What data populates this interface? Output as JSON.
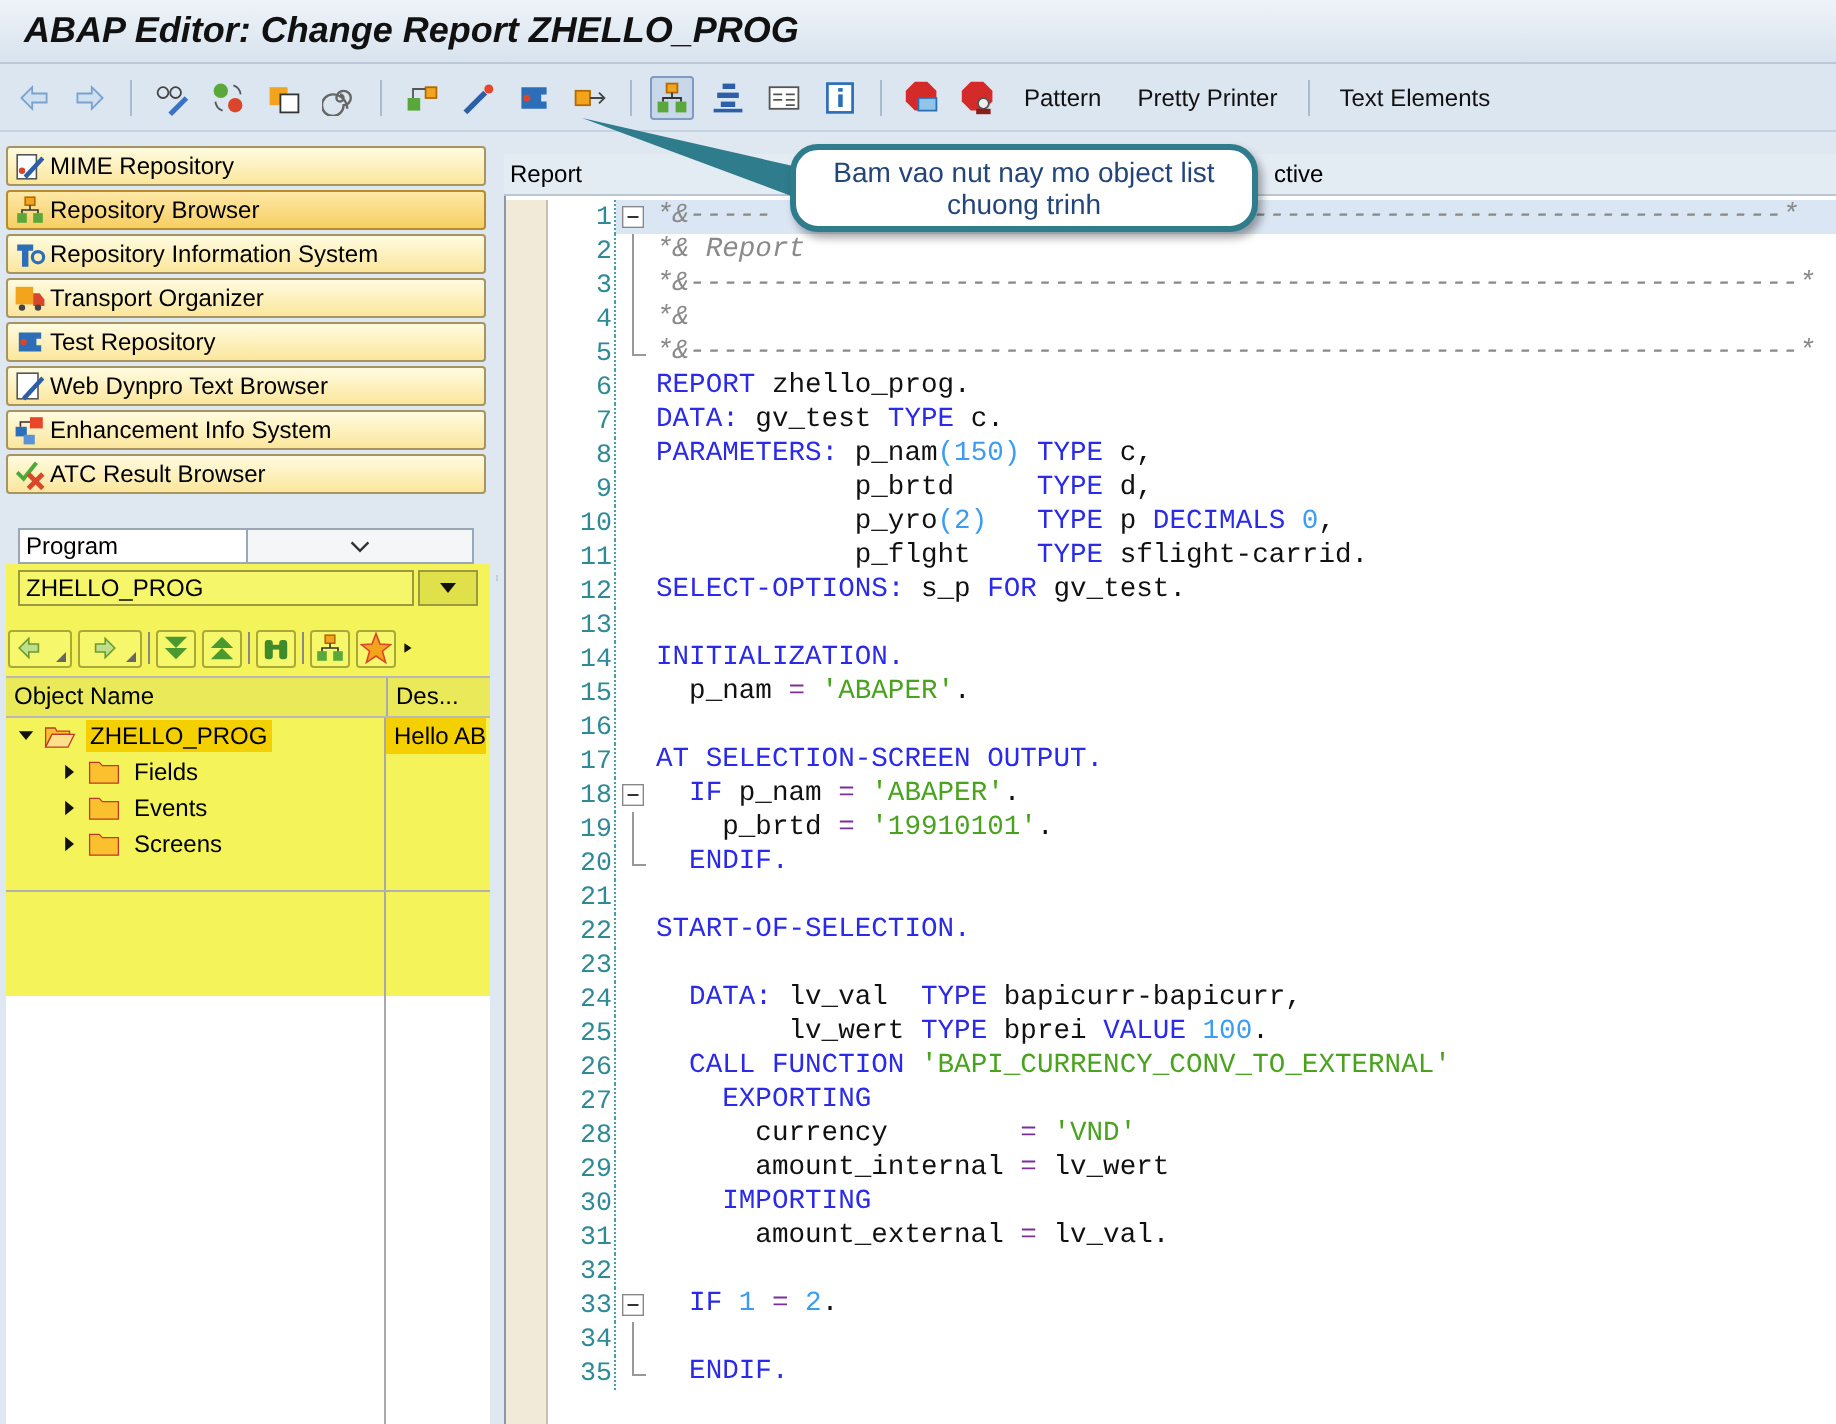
{
  "window": {
    "title": "ABAP Editor: Change Report ZHELLO_PROG"
  },
  "toolbar": [
    {
      "kind": "icon",
      "selected": false
    },
    {
      "kind": "icon",
      "selected": false
    },
    {
      "kind": "separator"
    },
    {
      "kind": "icon",
      "selected": false
    },
    {
      "kind": "icon",
      "selected": false
    },
    {
      "kind": "icon",
      "selected": false
    },
    {
      "kind": "icon",
      "selected": false
    },
    {
      "kind": "separator"
    },
    {
      "kind": "icon",
      "selected": false
    },
    {
      "kind": "icon",
      "selected": false
    },
    {
      "kind": "icon",
      "selected": false
    },
    {
      "kind": "icon",
      "selected": false
    },
    {
      "kind": "separator"
    },
    {
      "kind": "icon",
      "selected": true
    },
    {
      "kind": "icon",
      "selected": false
    },
    {
      "kind": "icon",
      "selected": false
    },
    {
      "kind": "icon",
      "selected": false
    },
    {
      "kind": "separator"
    },
    {
      "kind": "icon",
      "selected": false
    },
    {
      "kind": "icon",
      "selected": false
    },
    {
      "kind": "button",
      "label": "Pattern"
    },
    {
      "kind": "button",
      "label": "Pretty Printer"
    },
    {
      "kind": "separator"
    },
    {
      "kind": "button",
      "label": "Text Elements"
    }
  ],
  "navigation": [
    {
      "label": "MIME Repository",
      "selected": false
    },
    {
      "label": "Repository Browser",
      "selected": true
    },
    {
      "label": "Repository Information System",
      "selected": false
    },
    {
      "label": "Transport Organizer",
      "selected": false
    },
    {
      "label": "Test Repository",
      "selected": false
    },
    {
      "label": "Web Dynpro Text Browser",
      "selected": false
    },
    {
      "label": "Enhancement Info System",
      "selected": false
    },
    {
      "label": "ATC Result Browser",
      "selected": false
    }
  ],
  "object_type": {
    "value": "Program"
  },
  "object_name": {
    "value": "ZHELLO_PROG"
  },
  "tree": {
    "columns": [
      "Object Name",
      "Des..."
    ],
    "items": [
      {
        "label": "ZHELLO_PROG",
        "description": "Hello AB",
        "expanded": true,
        "selected": true,
        "children": [
          {
            "label": "Fields",
            "expanded": false,
            "selected": false
          },
          {
            "label": "Events",
            "expanded": false,
            "selected": false
          },
          {
            "label": "Screens",
            "expanded": false,
            "selected": false
          }
        ]
      }
    ]
  },
  "editor": {
    "tab": "Report",
    "status": "ctive",
    "lines": [
      {
        "number": "1",
        "highlighted": true,
        "expanded": true,
        "tokens": [
          {
            "kind": "comment",
            "text": "*&-----"
          },
          {
            "kind": "comment",
            "text": "                             --------------------------------*"
          }
        ],
        "children": [
          {
            "number": "2",
            "highlighted": false,
            "tokens": [
              {
                "kind": "comment",
                "text": "*& Report"
              }
            ]
          },
          {
            "number": "3",
            "highlighted": false,
            "tokens": [
              {
                "kind": "comment",
                "text": "*&-------------------------------------------------------------------*"
              }
            ]
          },
          {
            "number": "4",
            "highlighted": false,
            "tokens": [
              {
                "kind": "comment",
                "text": "*&"
              }
            ]
          },
          {
            "number": "5",
            "highlighted": false,
            "tokens": [
              {
                "kind": "comment",
                "text": "*&-------------------------------------------------------------------*"
              }
            ]
          }
        ]
      },
      {
        "number": "6",
        "highlighted": false,
        "tokens": [
          {
            "kind": "keyword",
            "text": "REPORT"
          },
          {
            "kind": "plain",
            "text": " zhello_prog."
          }
        ]
      },
      {
        "number": "7",
        "highlighted": false,
        "tokens": [
          {
            "kind": "keyword",
            "text": "DATA:"
          },
          {
            "kind": "plain",
            "text": " gv_test"
          },
          {
            "kind": "keyword",
            "text": " TYPE"
          },
          {
            "kind": "plain",
            "text": " c."
          }
        ]
      },
      {
        "number": "8",
        "highlighted": false,
        "tokens": [
          {
            "kind": "keyword",
            "text": "PARAMETERS:"
          },
          {
            "kind": "plain",
            "text": " p_nam"
          },
          {
            "kind": "number",
            "text": "(150)"
          },
          {
            "kind": "keyword",
            "text": " TYPE"
          },
          {
            "kind": "plain",
            "text": " c,"
          }
        ]
      },
      {
        "number": "9",
        "highlighted": false,
        "tokens": [
          {
            "kind": "plain",
            "text": "            p_brtd"
          },
          {
            "kind": "keyword",
            "text": "     TYPE"
          },
          {
            "kind": "plain",
            "text": " d,"
          }
        ]
      },
      {
        "number": "10",
        "highlighted": false,
        "tokens": [
          {
            "kind": "plain",
            "text": "            p_yro"
          },
          {
            "kind": "number",
            "text": "(2)"
          },
          {
            "kind": "keyword",
            "text": "   TYPE"
          },
          {
            "kind": "plain",
            "text": " p"
          },
          {
            "kind": "keyword",
            "text": " DECIMALS"
          },
          {
            "kind": "number",
            "text": " 0"
          },
          {
            "kind": "plain",
            "text": ","
          }
        ]
      },
      {
        "number": "11",
        "highlighted": false,
        "tokens": [
          {
            "kind": "plain",
            "text": "            p_flght"
          },
          {
            "kind": "keyword",
            "text": "    TYPE"
          },
          {
            "kind": "plain",
            "text": " sflight-carrid."
          }
        ]
      },
      {
        "number": "12",
        "highlighted": false,
        "tokens": [
          {
            "kind": "keyword",
            "text": "SELECT-OPTIONS:"
          },
          {
            "kind": "plain",
            "text": " s_p"
          },
          {
            "kind": "keyword",
            "text": " FOR"
          },
          {
            "kind": "plain",
            "text": " gv_test."
          }
        ]
      },
      {
        "number": "13",
        "highlighted": false
      },
      {
        "number": "14",
        "highlighted": false,
        "tokens": [
          {
            "kind": "keyword",
            "text": "INITIALIZATION."
          }
        ]
      },
      {
        "number": "15",
        "highlighted": false,
        "tokens": [
          {
            "kind": "plain",
            "text": "  p_nam"
          },
          {
            "kind": "operator",
            "text": " ="
          },
          {
            "kind": "string",
            "text": " 'ABAPER'"
          },
          {
            "kind": "plain",
            "text": "."
          }
        ]
      },
      {
        "number": "16",
        "highlighted": false
      },
      {
        "number": "17",
        "highlighted": false,
        "tokens": [
          {
            "kind": "keyword",
            "text": "AT SELECTION-SCREEN OUTPUT."
          }
        ]
      },
      {
        "number": "18",
        "highlighted": false,
        "expanded": true,
        "tokens": [
          {
            "kind": "keyword",
            "text": "  IF"
          },
          {
            "kind": "plain",
            "text": " p_nam"
          },
          {
            "kind": "operator",
            "text": " ="
          },
          {
            "kind": "string",
            "text": " 'ABAPER'"
          },
          {
            "kind": "plain",
            "text": "."
          }
        ],
        "children": [
          {
            "number": "19",
            "highlighted": false,
            "tokens": [
              {
                "kind": "plain",
                "text": "    p_brtd"
              },
              {
                "kind": "operator",
                "text": " ="
              },
              {
                "kind": "string",
                "text": " '19910101'"
              },
              {
                "kind": "plain",
                "text": "."
              }
            ]
          },
          {
            "number": "20",
            "highlighted": false,
            "tokens": [
              {
                "kind": "keyword",
                "text": "  ENDIF."
              }
            ]
          }
        ]
      },
      {
        "number": "21",
        "highlighted": false
      },
      {
        "number": "22",
        "highlighted": false,
        "tokens": [
          {
            "kind": "keyword",
            "text": "START-OF-SELECTION."
          }
        ]
      },
      {
        "number": "23",
        "highlighted": false
      },
      {
        "number": "24",
        "highlighted": false,
        "tokens": [
          {
            "kind": "keyword",
            "text": "  DATA:"
          },
          {
            "kind": "plain",
            "text": " lv_val"
          },
          {
            "kind": "keyword",
            "text": "  TYPE"
          },
          {
            "kind": "plain",
            "text": " bapicurr-bapicurr,"
          }
        ]
      },
      {
        "number": "25",
        "highlighted": false,
        "tokens": [
          {
            "kind": "plain",
            "text": "        lv_wert"
          },
          {
            "kind": "keyword",
            "text": " TYPE"
          },
          {
            "kind": "plain",
            "text": " bprei"
          },
          {
            "kind": "keyword",
            "text": " VALUE"
          },
          {
            "kind": "number",
            "text": " 100"
          },
          {
            "kind": "plain",
            "text": "."
          }
        ]
      },
      {
        "number": "26",
        "highlighted": false,
        "tokens": [
          {
            "kind": "keyword",
            "text": "  CALL FUNCTION"
          },
          {
            "kind": "string",
            "text": " 'BAPI_CURRENCY_CONV_TO_EXTERNAL'"
          }
        ]
      },
      {
        "number": "27",
        "highlighted": false,
        "tokens": [
          {
            "kind": "keyword",
            "text": "    EXPORTING"
          }
        ]
      },
      {
        "number": "28",
        "highlighted": false,
        "tokens": [
          {
            "kind": "plain",
            "text": "      currency"
          },
          {
            "kind": "operator",
            "text": "        ="
          },
          {
            "kind": "string",
            "text": " 'VND'"
          }
        ]
      },
      {
        "number": "29",
        "highlighted": false,
        "tokens": [
          {
            "kind": "plain",
            "text": "      amount_internal"
          },
          {
            "kind": "operator",
            "text": " ="
          },
          {
            "kind": "plain",
            "text": " lv_wert"
          }
        ]
      },
      {
        "number": "30",
        "highlighted": false,
        "tokens": [
          {
            "kind": "keyword",
            "text": "    IMPORTING"
          }
        ]
      },
      {
        "number": "31",
        "highlighted": false,
        "tokens": [
          {
            "kind": "plain",
            "text": "      amount_external"
          },
          {
            "kind": "operator",
            "text": " ="
          },
          {
            "kind": "plain",
            "text": " lv_val."
          }
        ]
      },
      {
        "number": "32",
        "highlighted": false
      },
      {
        "number": "33",
        "highlighted": false,
        "expanded": true,
        "tokens": [
          {
            "kind": "keyword",
            "text": "  IF"
          },
          {
            "kind": "number",
            "text": " 1"
          },
          {
            "kind": "operator",
            "text": " ="
          },
          {
            "kind": "number",
            "text": " 2"
          },
          {
            "kind": "plain",
            "text": "."
          }
        ],
        "children": [
          {
            "number": "34",
            "highlighted": false
          },
          {
            "number": "35",
            "highlighted": false,
            "tokens": [
              {
                "kind": "keyword",
                "text": "  ENDIF."
              }
            ]
          }
        ]
      }
    ]
  },
  "callout": {
    "text": "Bam vao nut nay mo object list chuong trinh"
  }
}
